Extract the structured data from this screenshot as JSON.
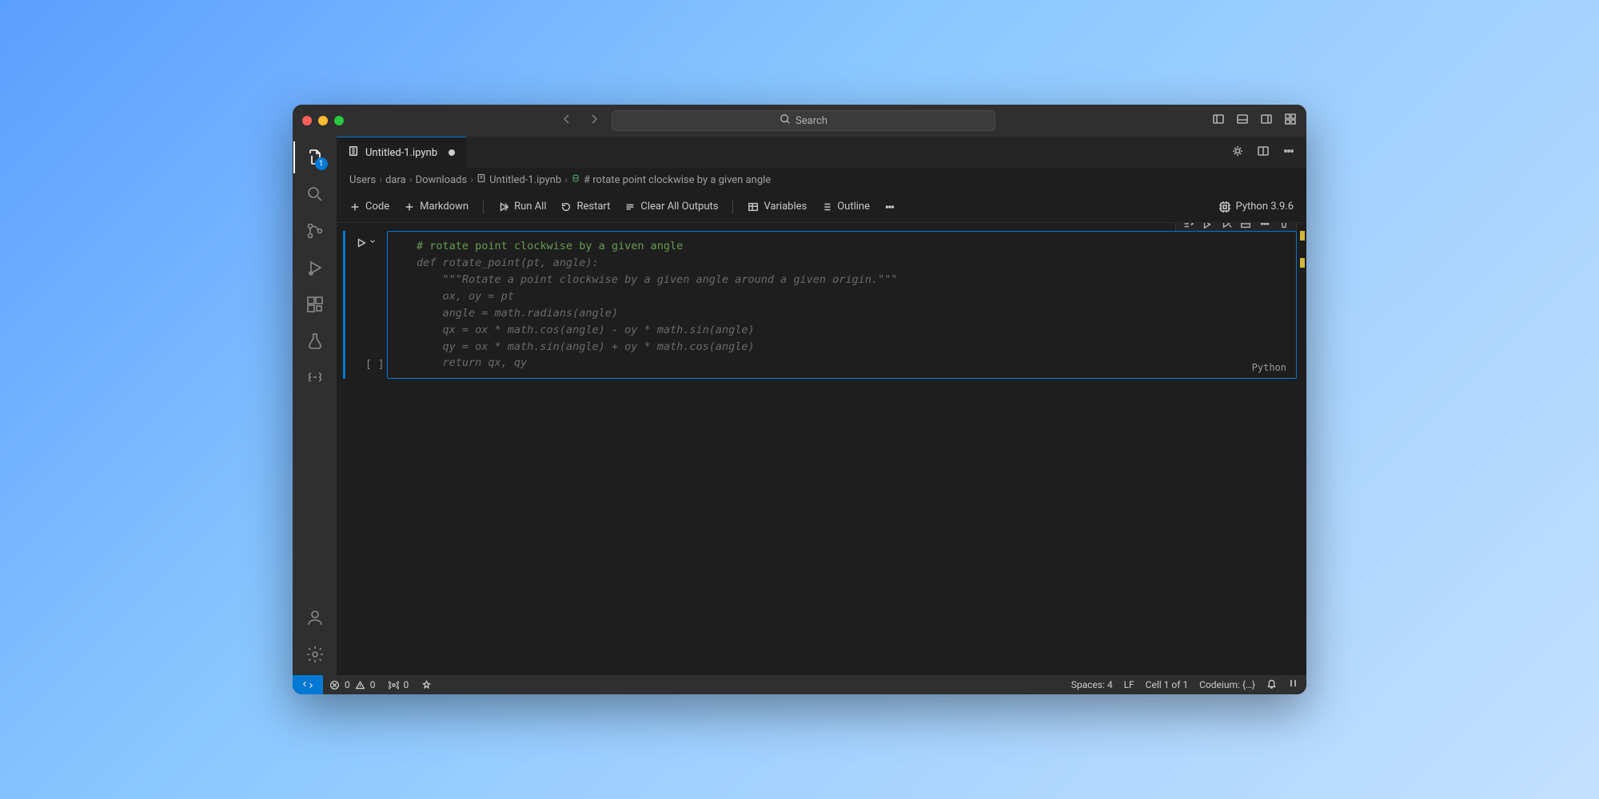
{
  "titlebar": {
    "search_placeholder": "Search"
  },
  "activity": {
    "badge": "1"
  },
  "tab": {
    "title": "Untitled-1.ipynb"
  },
  "breadcrumb": {
    "seg0": "Users",
    "seg1": "dara",
    "seg2": "Downloads",
    "seg3": "Untitled-1.ipynb",
    "seg4": "# rotate point clockwise by a given angle"
  },
  "toolbar": {
    "code": "Code",
    "markdown": "Markdown",
    "run_all": "Run All",
    "restart": "Restart",
    "clear": "Clear All Outputs",
    "variables": "Variables",
    "outline": "Outline",
    "kernel": "Python 3.9.6"
  },
  "cell": {
    "language": "Python",
    "l0": "# rotate point clockwise by a given angle",
    "l1": "def rotate_point(pt, angle):",
    "l2": "    \"\"\"Rotate a point clockwise by a given angle around a given origin.\"\"\"",
    "l3": "    ox, oy = pt",
    "l4": "    angle = math.radians(angle)",
    "l5": "    qx = ox * math.cos(angle) - oy * math.sin(angle)",
    "l6": "    qy = ox * math.sin(angle) + oy * math.cos(angle)",
    "l7": "    return qx, qy",
    "bracket": "[ ]"
  },
  "status": {
    "errors": "0",
    "warnings": "0",
    "ports": "0",
    "spaces": "Spaces: 4",
    "lf": "LF",
    "cell": "Cell 1 of 1",
    "codeium": "Codeium: {…}"
  }
}
